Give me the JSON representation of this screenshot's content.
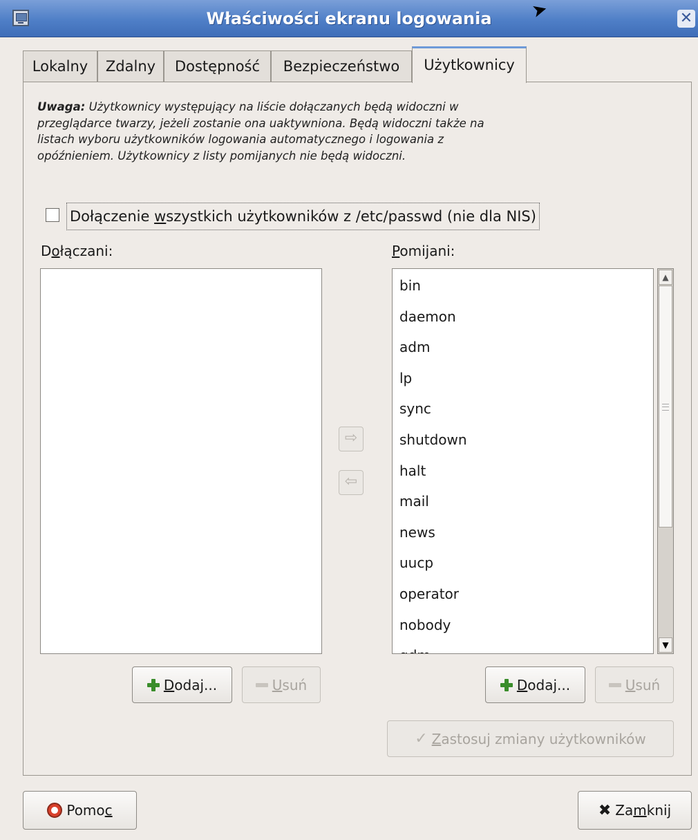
{
  "window": {
    "title": "Właściwości ekranu logowania",
    "close_glyph": "✕"
  },
  "tabs": [
    {
      "label": "Lokalny",
      "active": false
    },
    {
      "label": "Zdalny",
      "active": false
    },
    {
      "label": "Dostępność",
      "active": false
    },
    {
      "label": "Bezpieczeństwo",
      "active": false
    },
    {
      "label": "Użytkownicy",
      "active": true
    }
  ],
  "note": {
    "bold": "Uwaga:",
    "text": " Użytkownicy występujący na liście dołączanych będą widoczni w przeglądarce twarzy, jeżeli zostanie ona uaktywniona. Będą widoczni także na listach wyboru użytkowników logowania automatycznego i logowania z opóźnieniem. Użytkownicy z listy pomijanych nie będą widoczni."
  },
  "include_all": {
    "label_before": "Dołączenie ",
    "label_mnemonic": "w",
    "label_after": "szystkich użytkowników z /etc/passwd (nie dla NIS)",
    "checked": false
  },
  "included": {
    "label_before": "D",
    "label_mnemonic": "o",
    "label_after": "łączani:",
    "items": []
  },
  "excluded": {
    "label_before": "",
    "label_mnemonic": "P",
    "label_after": "omijani:",
    "items": [
      "bin",
      "daemon",
      "adm",
      "lp",
      "sync",
      "shutdown",
      "halt",
      "mail",
      "news",
      "uucp",
      "operator",
      "nobody",
      "gdm"
    ],
    "scroll_position_fraction": 0.0
  },
  "buttons": {
    "add_mnemonic": "D",
    "add_rest": "odaj...",
    "remove_mnemonic": "U",
    "remove_rest": "suń",
    "move_right_glyph": "⇨",
    "move_left_glyph": "⇦",
    "apply_mnemonic": "Z",
    "apply_rest": "astosuj zmiany użytkowników",
    "help_before": "Pomo",
    "help_mnemonic": "c",
    "close_before": "Za",
    "close_mnemonic": "m",
    "close_after": "knij"
  },
  "icons": {
    "window": "window-icon",
    "add": "plus-icon",
    "remove": "minus-icon",
    "apply": "check-icon",
    "help": "lifebuoy-icon",
    "close": "x-icon"
  }
}
